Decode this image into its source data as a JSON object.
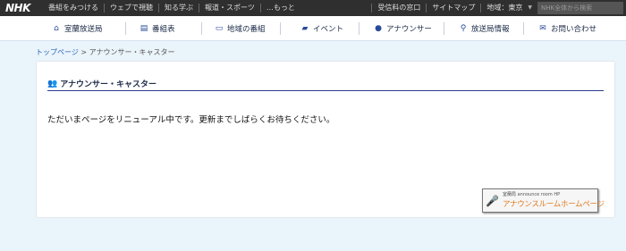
{
  "topbar": {
    "logo": "NHK",
    "links": [
      "番組をみつける",
      "ウェブで視聴",
      "知る学ぶ",
      "報道・スポーツ",
      "…もっと"
    ],
    "right_links": [
      "受信料の窓口",
      "サイトマップ"
    ],
    "region_label": "地域：東京",
    "search_placeholder": "NHK全体から検索"
  },
  "nav": {
    "items": [
      {
        "label": "室蘭放送局",
        "icon": "home-icon"
      },
      {
        "label": "番組表",
        "icon": "program-guide-icon"
      },
      {
        "label": "地域の番組",
        "icon": "tv-icon"
      },
      {
        "label": "イベント",
        "icon": "ticket-icon"
      },
      {
        "label": "アナウンサー",
        "icon": "person-icon"
      },
      {
        "label": "放送局情報",
        "icon": "antenna-icon"
      },
      {
        "label": "お問い合わせ",
        "icon": "mail-icon"
      }
    ]
  },
  "breadcrumb": {
    "home": "トップページ",
    "separator": " > ",
    "current": "アナウンサー・キャスター"
  },
  "panel": {
    "title": "アナウンサー・キャスター",
    "message": "ただいまページをリニューアル中です。更新までしばらくお待ちください。"
  },
  "banner": {
    "subtitle": "室蘭局 announce room HP",
    "title": "アナウンスルームホームページ"
  }
}
